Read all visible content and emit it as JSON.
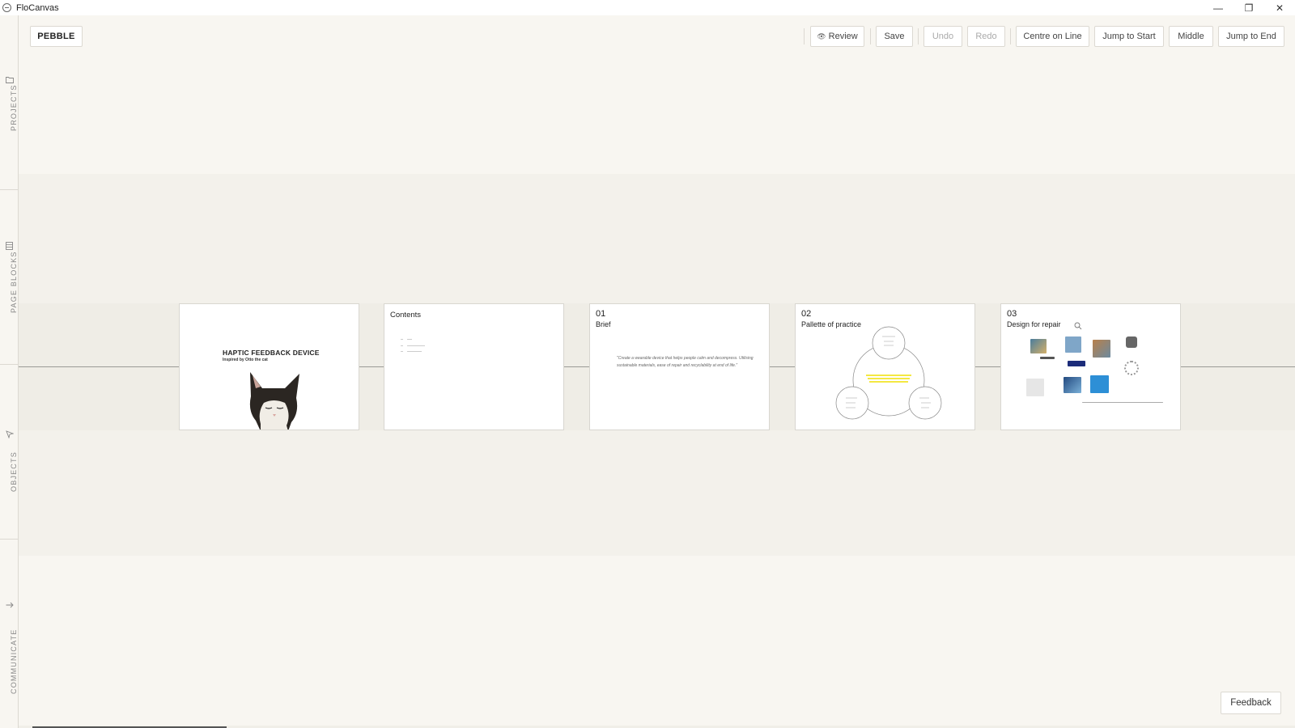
{
  "window": {
    "title": "FloCanvas",
    "controls": {
      "minimize": "—",
      "maximize": "❐",
      "close": "✕"
    }
  },
  "sidebar": {
    "sections": [
      {
        "label": "PROJECTS",
        "icon": "folder-icon"
      },
      {
        "label": "PAGE BLOCKS",
        "icon": "blocks-icon"
      },
      {
        "label": "OBJECTS",
        "icon": "pointer-icon"
      },
      {
        "label": "COMMUNICATE",
        "icon": "arrow-right-icon"
      }
    ]
  },
  "toolbar": {
    "project_name": "PEBBLE",
    "review_label": "Review",
    "save_label": "Save",
    "undo_label": "Undo",
    "redo_label": "Redo",
    "centre_label": "Centre on Line",
    "jump_start_label": "Jump to Start",
    "middle_label": "Middle",
    "jump_end_label": "Jump to End"
  },
  "pages": {
    "cover": {
      "title": "HAPTIC FEEDBACK DEVICE",
      "subtitle": "Inspired by Otto the cat"
    },
    "contents": {
      "title": "Contents"
    },
    "brief": {
      "number": "01",
      "title": "Brief",
      "quote": "\"Create a wearable device that helps people calm and decompress. Utilising sustainable materials, ease of repair and recyclability at end of life.\""
    },
    "practice": {
      "number": "02",
      "title": "Pallette of practice"
    },
    "repair": {
      "number": "03",
      "title": "Design for repair"
    }
  },
  "colors": {
    "canvas_bg": "#f8f6f1",
    "band": "#efede6",
    "highlight": "#f4e842"
  },
  "feedback_label": "Feedback"
}
